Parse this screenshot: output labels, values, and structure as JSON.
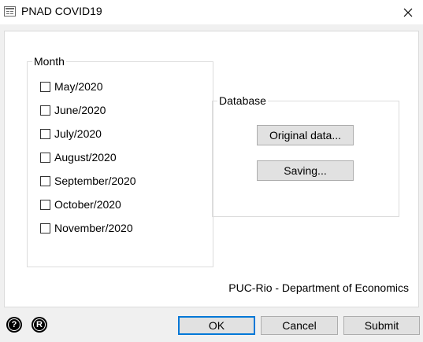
{
  "window": {
    "title": "PNAD COVID19"
  },
  "month_group": {
    "legend": "Month",
    "items": [
      {
        "label": "May/2020",
        "checked": false
      },
      {
        "label": "June/2020",
        "checked": false
      },
      {
        "label": "July/2020",
        "checked": false
      },
      {
        "label": "August/2020",
        "checked": false
      },
      {
        "label": "September/2020",
        "checked": false
      },
      {
        "label": "October/2020",
        "checked": false
      },
      {
        "label": "November/2020",
        "checked": false
      }
    ]
  },
  "database_group": {
    "legend": "Database",
    "original_label": "Original data...",
    "saving_label": "Saving..."
  },
  "footer": {
    "credit": "PUC-Rio - Department of Economics"
  },
  "buttons": {
    "ok": "OK",
    "cancel": "Cancel",
    "submit": "Submit"
  },
  "icons": {
    "help": "?",
    "r": "R"
  },
  "colors": {
    "default_button_border": "#0078d7"
  }
}
